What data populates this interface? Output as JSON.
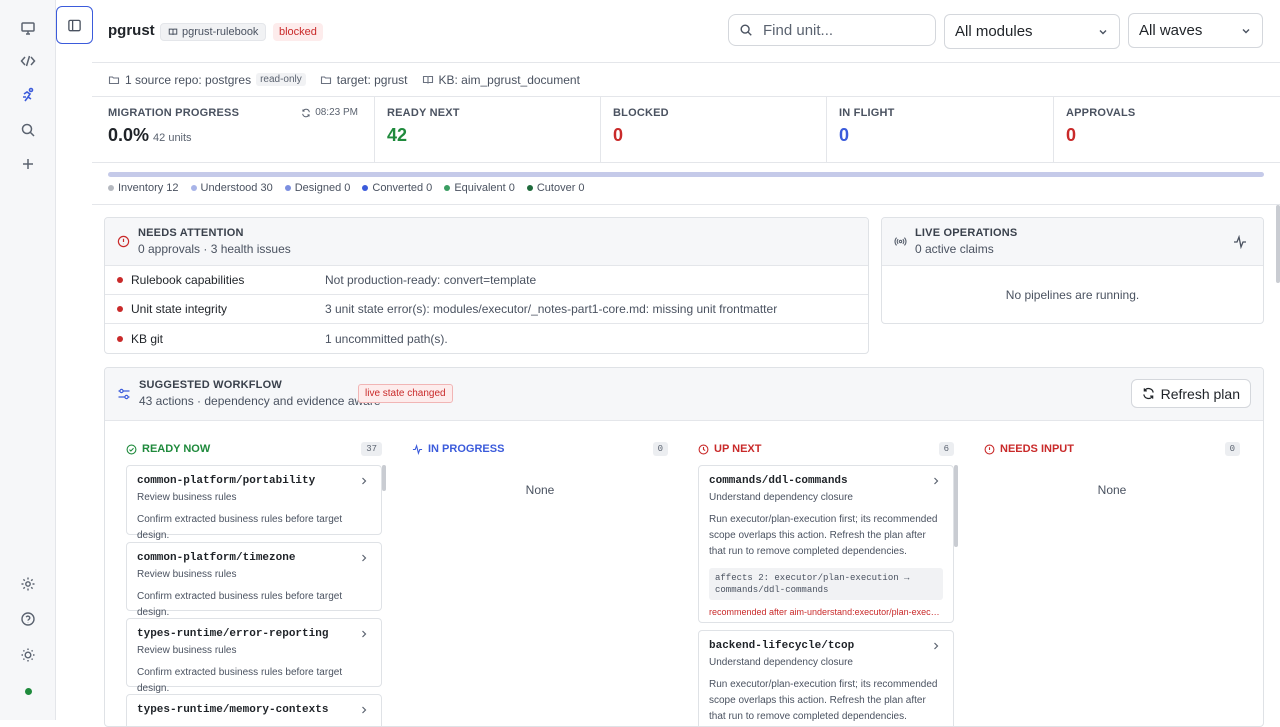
{
  "project": {
    "title": "pgrust",
    "rulebook": "pgrust-rulebook",
    "status": "blocked"
  },
  "search": {
    "placeholder": "Find unit..."
  },
  "filters": {
    "modules": "All modules",
    "waves": "All waves"
  },
  "meta": {
    "source": "1 source repo: postgres",
    "readonly": "read-only",
    "target": "target: pgrust",
    "kb": "KB: aim_pgrust_document"
  },
  "stats": {
    "progress_label": "MIGRATION PROGRESS",
    "progress_value": "0.0%",
    "progress_units": "42 units",
    "progress_time": "08:23 PM",
    "progress_fraction": 0.0,
    "ready_label": "READY NEXT",
    "ready_value": "42",
    "blocked_label": "BLOCKED",
    "blocked_value": "0",
    "inflight_label": "IN FLIGHT",
    "inflight_value": "0",
    "approvals_label": "APPROVALS",
    "approvals_value": "0"
  },
  "legend": [
    {
      "label": "Inventory 12",
      "color": "#b5b9c0"
    },
    {
      "label": "Understood 30",
      "color": "#a8b4e8"
    },
    {
      "label": "Designed 0",
      "color": "#7c8fe0"
    },
    {
      "label": "Converted 0",
      "color": "#3b5bdb"
    },
    {
      "label": "Equivalent 0",
      "color": "#3a9d62"
    },
    {
      "label": "Cutover 0",
      "color": "#1f6b3c"
    }
  ],
  "attention": {
    "title": "NEEDS ATTENTION",
    "subtitle": "0 approvals · 3 health issues",
    "rows": [
      {
        "name": "Rulebook capabilities",
        "detail": "Not production-ready: convert=template"
      },
      {
        "name": "Unit state integrity",
        "detail": "3 unit state error(s): modules/executor/_notes-part1-core.md: missing unit frontmatter"
      },
      {
        "name": "KB git",
        "detail": "1 uncommitted path(s)."
      }
    ]
  },
  "live": {
    "title": "LIVE OPERATIONS",
    "subtitle": "0 active claims",
    "empty": "No pipelines are running."
  },
  "workflow": {
    "title": "SUGGESTED WORKFLOW",
    "subtitle": "43 actions · dependency and evidence aware",
    "tag": "live state changed",
    "refresh": "Refresh plan",
    "columns": {
      "ready": {
        "title": "READY NOW",
        "count": "37",
        "color": "#1f8a3c"
      },
      "progress": {
        "title": "IN PROGRESS",
        "count": "0",
        "color": "#3b5bdb",
        "empty": "None"
      },
      "next": {
        "title": "UP NEXT",
        "count": "6",
        "color": "#c92a2a"
      },
      "input": {
        "title": "NEEDS INPUT",
        "count": "0",
        "color": "#c92a2a",
        "empty": "None"
      }
    },
    "ready_cards": [
      {
        "title": "common-platform/portability",
        "action": "Review business rules",
        "desc": "Confirm extracted business rules before target design."
      },
      {
        "title": "common-platform/timezone",
        "action": "Review business rules",
        "desc": "Confirm extracted business rules before target design."
      },
      {
        "title": "types-runtime/error-reporting",
        "action": "Review business rules",
        "desc": "Confirm extracted business rules before target design."
      },
      {
        "title": "types-runtime/memory-contexts",
        "action": "",
        "desc": ""
      }
    ],
    "next_cards": [
      {
        "title": "commands/ddl-commands",
        "action": "Understand dependency closure",
        "desc": "Run executor/plan-execution first; its recommended scope overlaps this action. Refresh the plan after that run to remove completed dependencies.",
        "affects": "affects 2: executor/plan-execution → commands/ddl-commands",
        "rec": "recommended after aim-understand:executor/plan-execution..."
      },
      {
        "title": "backend-lifecycle/tcop",
        "action": "Understand dependency closure",
        "desc": "Run executor/plan-execution first; its recommended scope overlaps this action. Refresh the plan after that run to remove completed dependencies."
      }
    ]
  }
}
